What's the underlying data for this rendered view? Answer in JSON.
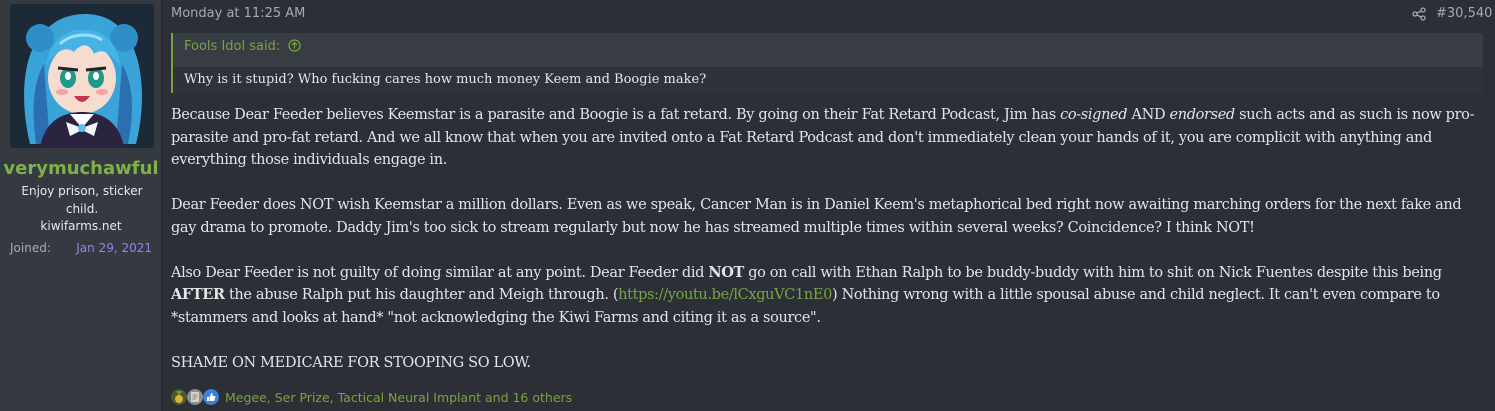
{
  "user": {
    "username": "verymuchawful",
    "title": "Enjoy prison, sticker child.",
    "site": "kiwifarms.net",
    "joined_label": "Joined:",
    "joined_date": "Jan 29, 2021"
  },
  "post": {
    "timestamp": "Monday at 11:25 AM",
    "number": "#30,540",
    "quote": {
      "author": "Fools Idol said:",
      "text": "Why is it stupid? Who fucking cares how much money Keem and Boogie make?"
    },
    "body": {
      "p1_a": "Because Dear Feeder believes Keemstar is a parasite and Boogie is a fat retard. By going on their Fat Retard Podcast, Jim has ",
      "p1_em1": "co-signed",
      "p1_b": " AND ",
      "p1_em2": "endorsed",
      "p1_c": " such acts and as such is now pro-parasite and pro-fat retard. And we all know that when you are invited onto a Fat Retard Podcast and don't immediately clean your hands of it, you are complicit with anything and everything those individuals engage in.",
      "p2": "Dear Feeder does NOT wish Keemstar a million dollars. Even as we speak, Cancer Man is in Daniel Keem's metaphorical bed right now awaiting marching orders for the next fake and gay drama to promote. Daddy Jim's too sick to stream regularly but now he has streamed multiple times within several weeks? Coincidence? I think NOT!",
      "p3_a": "Also Dear Feeder is not guilty of doing similar at any point. Dear Feeder did ",
      "p3_b1": "NOT",
      "p3_b": " go on call with Ethan Ralph to be buddy-buddy with him to shit on Nick Fuentes despite this being ",
      "p3_b2": "AFTER",
      "p3_c": " the abuse Ralph put his daughter and Meigh through. (",
      "p3_link": "https://youtu.be/lCxguVC1nE0",
      "p3_d": ") Nothing wrong with a little spousal abuse and child neglect. It can't even compare to *stammers and looks at hand* \"not acknowledging the Kiwi Farms and citing it as a source\".",
      "p4": "SHAME ON MEDICARE FOR STOOPING SO LOW."
    },
    "reactions_text": "Megee, Ser Prize, Tactical Neural Implant and 16 others",
    "reaction_icons": [
      "medal-icon",
      "scroll-icon",
      "thumbs-up-icon"
    ]
  },
  "colors": {
    "accent_green": "#7aa33f",
    "username_green": "#80b04a",
    "joined_purple": "#9d7df0",
    "background": "#2c3036",
    "user_panel": "#353a41"
  }
}
